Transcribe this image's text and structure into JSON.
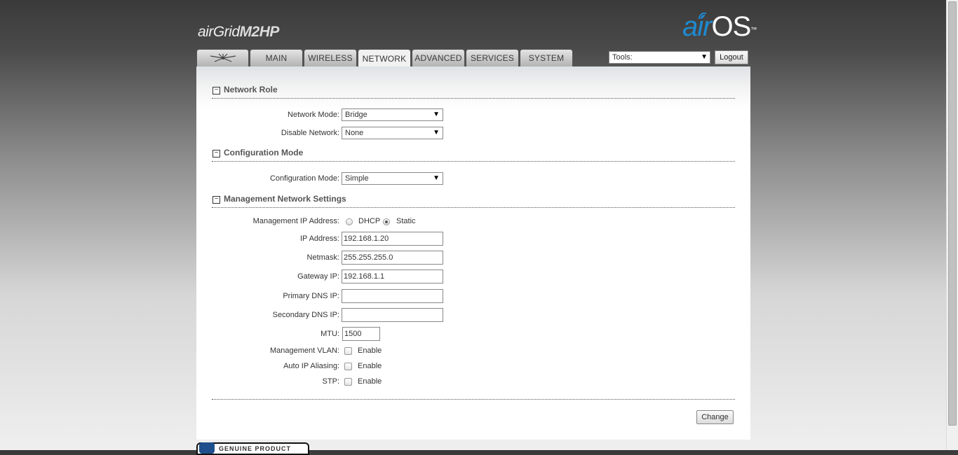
{
  "header": {
    "product_air": "air",
    "product_grid": "Grid",
    "product_model": "M2HP",
    "os_air": "air",
    "os_os": "OS",
    "os_tm": "™"
  },
  "tabs": [
    {
      "label": "",
      "icon": "ubiquiti-logo-icon"
    },
    {
      "label": "MAIN"
    },
    {
      "label": "WIRELESS"
    },
    {
      "label": "NETWORK",
      "active": true
    },
    {
      "label": "ADVANCED"
    },
    {
      "label": "SERVICES"
    },
    {
      "label": "SYSTEM"
    }
  ],
  "tools": {
    "selected": "Tools:"
  },
  "logout_label": "Logout",
  "network_role": {
    "title": "Network Role",
    "network_mode_label": "Network Mode:",
    "network_mode_value": "Bridge",
    "disable_network_label": "Disable Network:",
    "disable_network_value": "None"
  },
  "configuration": {
    "title": "Configuration Mode",
    "mode_label": "Configuration Mode:",
    "mode_value": "Simple"
  },
  "management": {
    "title": "Management Network Settings",
    "ip_mode_label": "Management IP Address:",
    "dhcp_label": "DHCP",
    "static_label": "Static",
    "ip_label": "IP Address:",
    "ip_value": "192.168.1.20",
    "netmask_label": "Netmask:",
    "netmask_value": "255.255.255.0",
    "gateway_label": "Gateway IP:",
    "gateway_value": "192.168.1.1",
    "dns1_label": "Primary DNS IP:",
    "dns1_value": "",
    "dns2_label": "Secondary DNS IP:",
    "dns2_value": "",
    "mtu_label": "MTU:",
    "mtu_value": "1500",
    "vlan_label": "Management VLAN:",
    "alias_label": "Auto IP Aliasing:",
    "stp_label": "STP:",
    "enable_label": "Enable"
  },
  "change_label": "Change",
  "footer": {
    "genuine": "GENUINE  PRODUCT"
  },
  "colors": {
    "airos_blue": "#1f8ad0"
  }
}
